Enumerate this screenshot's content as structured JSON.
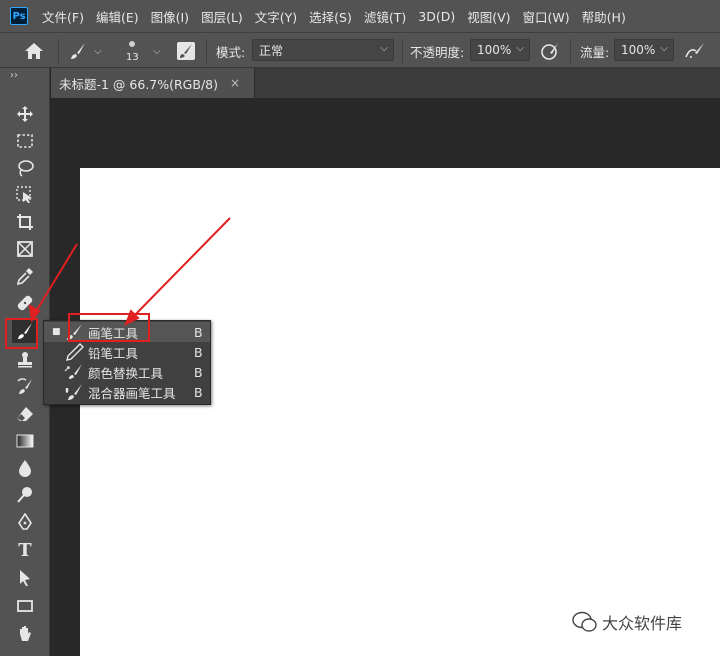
{
  "app": {
    "logo": "Ps"
  },
  "menus": [
    "文件(F)",
    "编辑(E)",
    "图像(I)",
    "图层(L)",
    "文字(Y)",
    "选择(S)",
    "滤镜(T)",
    "3D(D)",
    "视图(V)",
    "窗口(W)",
    "帮助(H)"
  ],
  "options": {
    "brush_size": "13",
    "mode_label": "模式:",
    "mode_value": "正常",
    "opacity_label": "不透明度:",
    "opacity_value": "100%",
    "flow_label": "流量:",
    "flow_value": "100%"
  },
  "document": {
    "tab_title": "未标题-1 @ 66.7%(RGB/8)"
  },
  "flyout": {
    "items": [
      {
        "label": "画笔工具",
        "key": "B",
        "icon": "brush-icon",
        "selected": true
      },
      {
        "label": "铅笔工具",
        "key": "B",
        "icon": "pencil-icon",
        "selected": false
      },
      {
        "label": "颜色替换工具",
        "key": "B",
        "icon": "color-replacement-icon",
        "selected": false
      },
      {
        "label": "混合器画笔工具",
        "key": "B",
        "icon": "mixer-brush-icon",
        "selected": false
      }
    ]
  },
  "toolbar": {
    "tools": [
      "move-icon",
      "marquee-icon",
      "lasso-icon",
      "object-select-icon",
      "crop-icon",
      "frame-icon",
      "eyedropper-icon",
      "healing-icon",
      "brush-icon",
      "stamp-icon",
      "history-brush-icon",
      "eraser-icon",
      "gradient-icon",
      "blur-icon",
      "dodge-icon",
      "pen-icon",
      "type-icon",
      "path-select-icon",
      "rectangle-icon",
      "hand-icon"
    ],
    "type_glyph": "T"
  },
  "watermark": {
    "text": "大众软件库"
  },
  "colors": {
    "annotation": "#e02020",
    "ps_blue": "#31a8ff"
  }
}
